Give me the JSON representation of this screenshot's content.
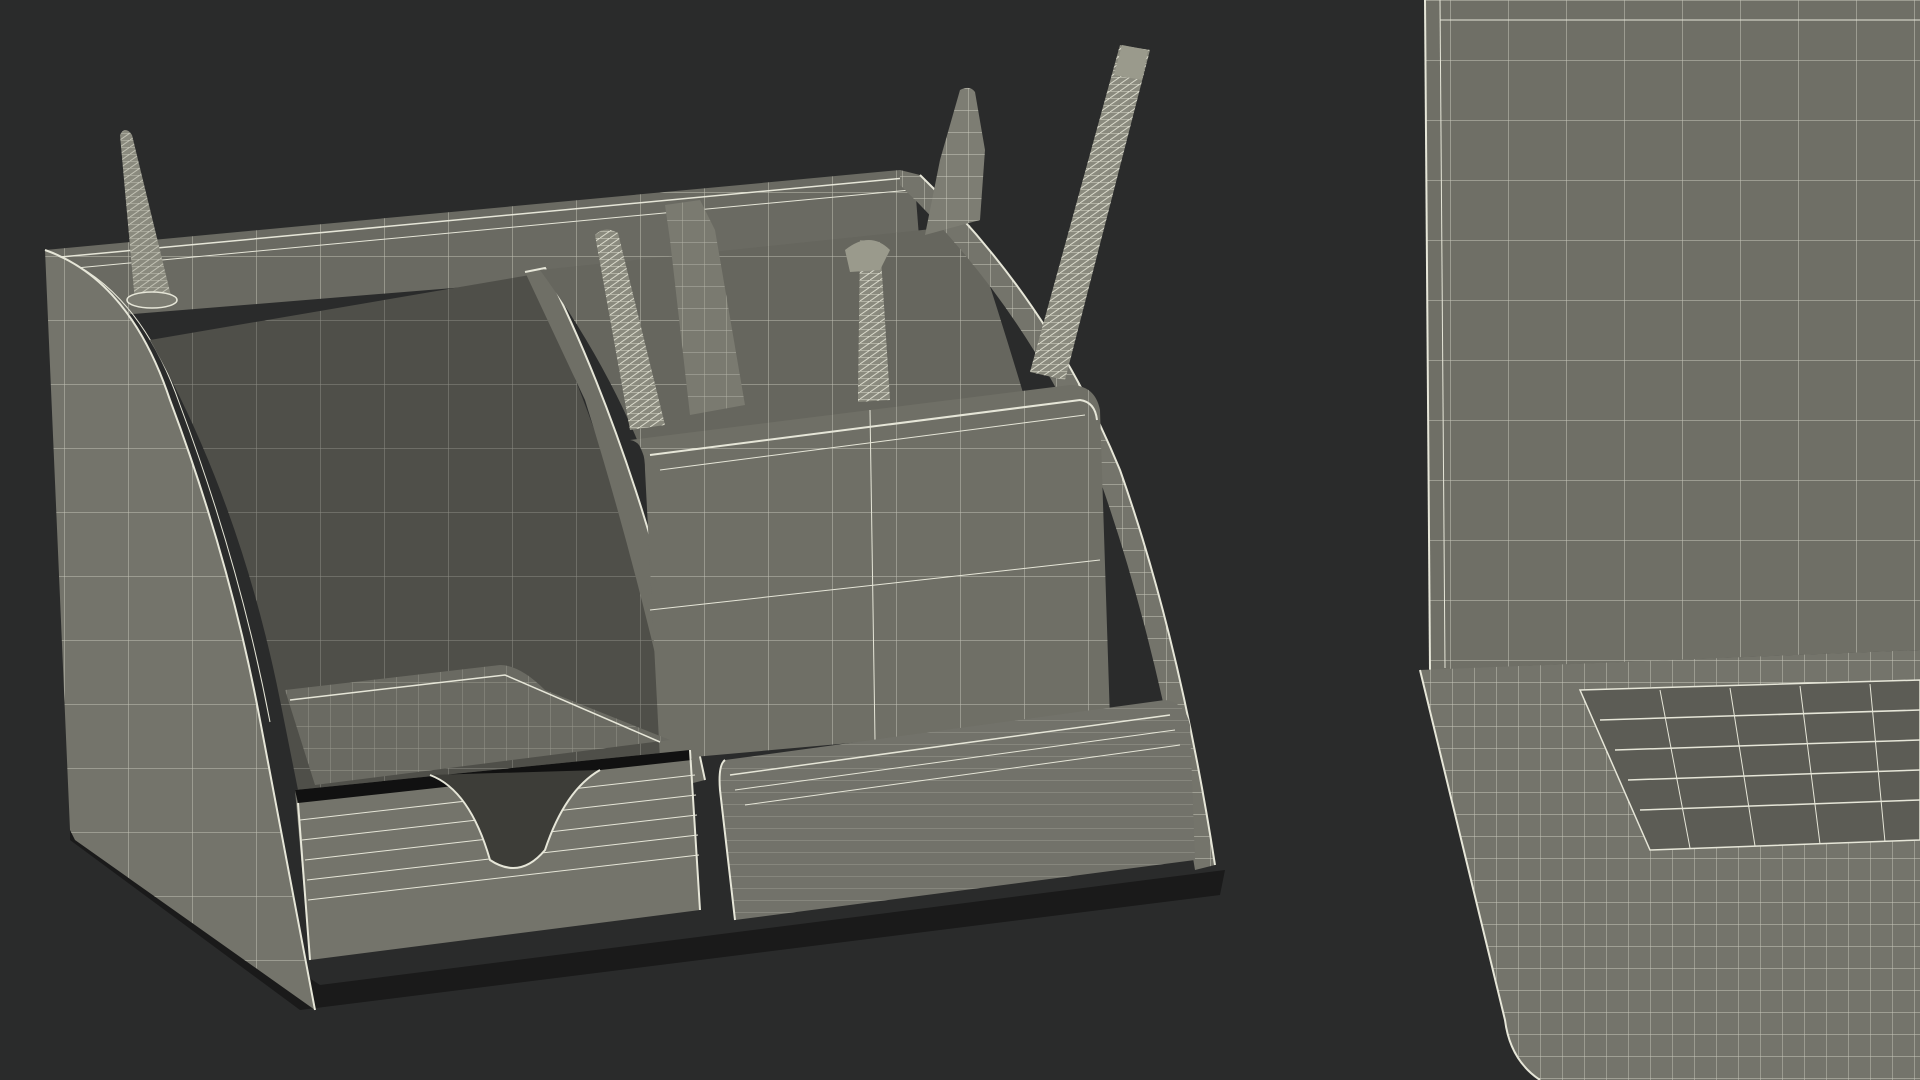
{
  "scene": {
    "background": "#2a2b2b",
    "surface": "#6f6f66",
    "surface_light": "#7d7d73",
    "surface_dark": "#55554e",
    "interior": "#4d4d47",
    "shadow": "#1a1a1a",
    "wire": "#e6e6d8",
    "objects": [
      "desk-organizer",
      "pens-and-pencils",
      "laptop"
    ]
  }
}
